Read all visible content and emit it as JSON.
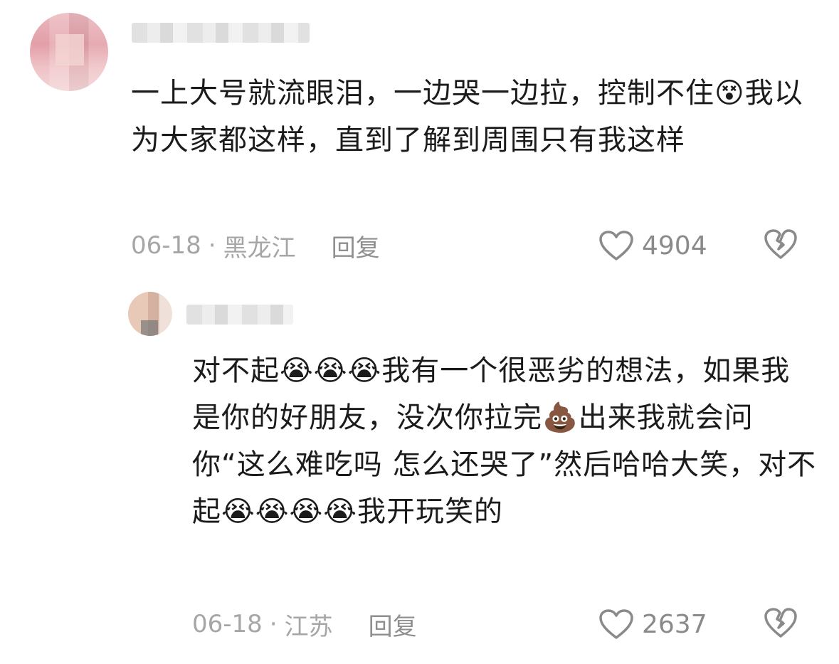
{
  "comments": [
    {
      "body": "一上大号就流眼泪，一边哭一边拉，控制不住😵我以为大家都这样，直到了解到周围只有我这样",
      "date": "06-18",
      "separator": "·",
      "location": "黑龙江",
      "reply_label": "回复",
      "like_count": "4904"
    },
    {
      "body": "对不起😭😭😭我有一个很恶劣的想法，如果我是你的好朋友，没次你拉完💩出来我就会问你“这么难吃吗 怎么还哭了”然后哈哈大笑，对不起😭😭😭😭我开玩笑的",
      "date": "06-18",
      "separator": "·",
      "location": "江苏",
      "reply_label": "回复",
      "like_count": "2637"
    }
  ],
  "icons": {
    "like": "heart-outline-icon",
    "dislike": "broken-heart-icon"
  },
  "colors": {
    "text": "#1b1b1b",
    "meta": "#a6a6a6",
    "icon": "#8a8a8a"
  }
}
